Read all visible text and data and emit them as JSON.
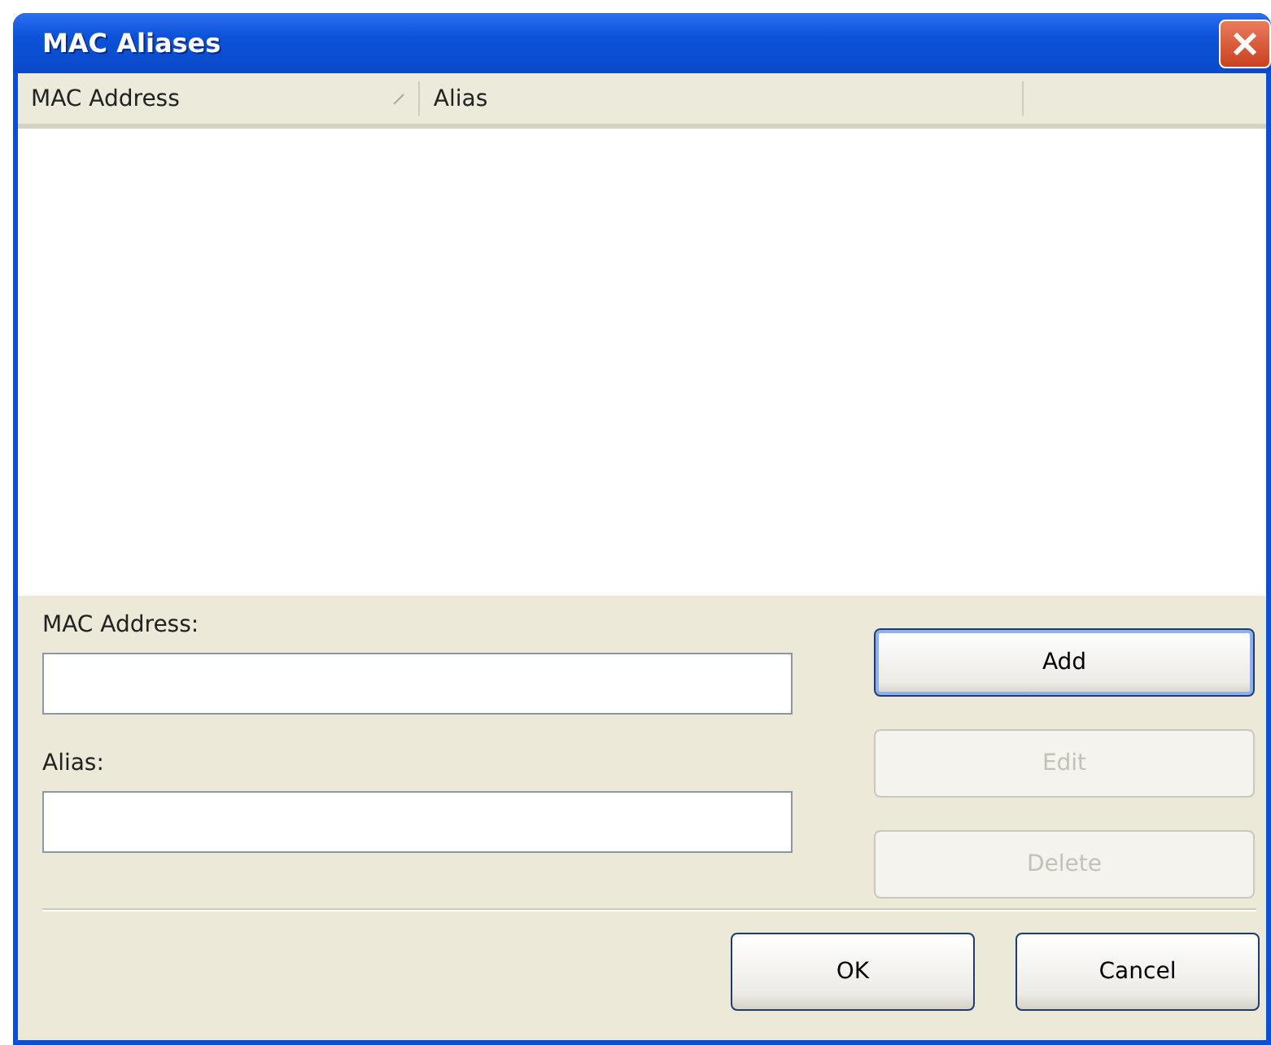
{
  "window": {
    "title": "MAC Aliases"
  },
  "list": {
    "columns": [
      {
        "label": "MAC Address",
        "sorted": true
      },
      {
        "label": "Alias",
        "sorted": false
      }
    ]
  },
  "fields": [
    {
      "label": "MAC Address:"
    },
    {
      "label": "Alias:"
    }
  ],
  "side_buttons": [
    {
      "label": "Add",
      "disabled": false,
      "default": true
    },
    {
      "label": "Edit",
      "disabled": true,
      "default": false
    },
    {
      "label": "Delete",
      "disabled": true,
      "default": false
    }
  ],
  "footer_buttons": [
    {
      "label": "OK"
    },
    {
      "label": "Cancel"
    }
  ]
}
